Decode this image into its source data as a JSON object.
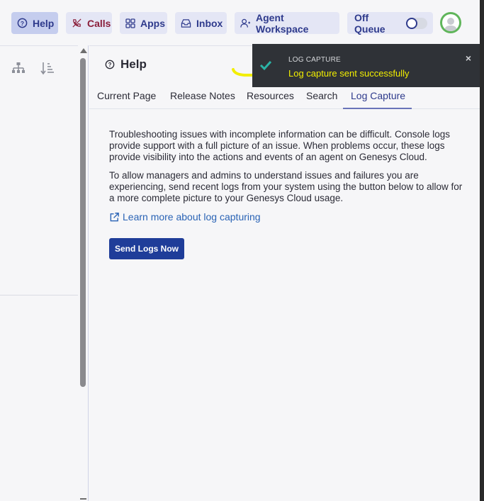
{
  "toolbar": {
    "help_label": "Help",
    "calls_label": "Calls",
    "apps_label": "Apps",
    "inbox_label": "Inbox",
    "agent_workspace_label": "Agent Workspace",
    "queue_status_label": "Off Queue",
    "queue_toggle_on": false
  },
  "help_panel": {
    "title": "Help",
    "tabs": [
      {
        "label": "Current Page",
        "active": false
      },
      {
        "label": "Release Notes",
        "active": false
      },
      {
        "label": "Resources",
        "active": false
      },
      {
        "label": "Search",
        "active": false
      },
      {
        "label": "Log Capture",
        "active": true
      }
    ],
    "paragraph_1": "Troubleshooting issues with incomplete information can be difficult. Console logs provide support with a full picture of an issue. When problems occur, these logs provide visibility into the actions and events of an agent on Genesys Cloud.",
    "paragraph_2": "To allow managers and admins to understand issues and failures you are experiencing, send recent logs from your system using the button below to allow for a more complete picture to your Genesys Cloud usage.",
    "learn_more_link": "Learn more about log capturing",
    "send_button_label": "Send Logs Now"
  },
  "toast": {
    "heading": "LOG CAPTURE",
    "message": "Log capture sent successfully",
    "close_glyph": "×"
  },
  "colors": {
    "accent": "#2e3a8c",
    "primary_button": "#1f3d99",
    "toast_bg": "#2f3237",
    "toast_message": "#f2ee00",
    "success_check": "#2ab3a6",
    "calls_accent": "#8a1e3a",
    "avatar_ring": "#5fb55a"
  }
}
